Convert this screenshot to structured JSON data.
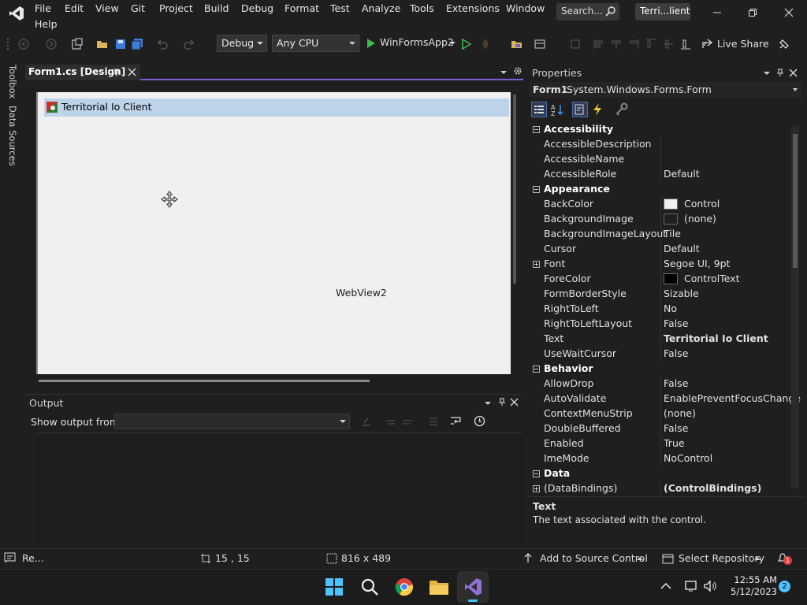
{
  "titlebar": {
    "menus": [
      "File",
      "Edit",
      "View",
      "Git",
      "Project",
      "Build",
      "Debug",
      "Format",
      "Test",
      "Analyze",
      "Tools",
      "Extensions",
      "Window",
      "Help"
    ],
    "search_label": "Search...",
    "solution_name": "Terri...lient"
  },
  "toolbar": {
    "config": "Debug",
    "platform": "Any CPU",
    "run_target": "WinFormsApp2",
    "live_share": "Live Share"
  },
  "leftstrip": {
    "toolbox": "Toolbox",
    "data_sources": "Data Sources"
  },
  "document": {
    "tab_title": "Form1.cs [Design]",
    "form_title": "Territorial Io Client",
    "control_label": "WebView2"
  },
  "output": {
    "title": "Output",
    "show_from_label": "Show output from:",
    "show_from_value": ""
  },
  "properties": {
    "title": "Properties",
    "object_name": "Form1",
    "object_type": "System.Windows.Forms.Form",
    "rows": [
      {
        "kind": "cat",
        "name": "Accessibility",
        "value": ""
      },
      {
        "kind": "prop",
        "name": "AccessibleDescription",
        "value": ""
      },
      {
        "kind": "prop",
        "name": "AccessibleName",
        "value": ""
      },
      {
        "kind": "prop",
        "name": "AccessibleRole",
        "value": "Default"
      },
      {
        "kind": "cat",
        "name": "Appearance",
        "value": ""
      },
      {
        "kind": "prop",
        "name": "BackColor",
        "value": "Control",
        "swatch": "#f0f0f0"
      },
      {
        "kind": "prop",
        "name": "BackgroundImage",
        "value": "(none)",
        "swatch": "#1f1f1f"
      },
      {
        "kind": "prop",
        "name": "BackgroundImageLayout",
        "value": "Tile"
      },
      {
        "kind": "prop",
        "name": "Cursor",
        "value": "Default"
      },
      {
        "kind": "expand",
        "name": "Font",
        "value": "Segoe UI, 9pt"
      },
      {
        "kind": "prop",
        "name": "ForeColor",
        "value": "ControlText",
        "swatch": "#000000"
      },
      {
        "kind": "prop",
        "name": "FormBorderStyle",
        "value": "Sizable"
      },
      {
        "kind": "prop",
        "name": "RightToLeft",
        "value": "No"
      },
      {
        "kind": "prop",
        "name": "RightToLeftLayout",
        "value": "False"
      },
      {
        "kind": "prop",
        "name": "Text",
        "value": "Territorial Io Client",
        "bold": true
      },
      {
        "kind": "prop",
        "name": "UseWaitCursor",
        "value": "False"
      },
      {
        "kind": "cat",
        "name": "Behavior",
        "value": ""
      },
      {
        "kind": "prop",
        "name": "AllowDrop",
        "value": "False"
      },
      {
        "kind": "prop",
        "name": "AutoValidate",
        "value": "EnablePreventFocusChange"
      },
      {
        "kind": "prop",
        "name": "ContextMenuStrip",
        "value": "(none)"
      },
      {
        "kind": "prop",
        "name": "DoubleBuffered",
        "value": "False"
      },
      {
        "kind": "prop",
        "name": "Enabled",
        "value": "True"
      },
      {
        "kind": "prop",
        "name": "ImeMode",
        "value": "NoControl"
      },
      {
        "kind": "cat",
        "name": "Data",
        "value": ""
      },
      {
        "kind": "expand",
        "name": "(DataBindings)",
        "value": "(ControlBindings)",
        "bold": true
      }
    ],
    "desc_title": "Text",
    "desc_text": "The text associated with the control."
  },
  "statusbar": {
    "ready": "Re...",
    "position": "15 , 15",
    "size": "816 x 489",
    "add_source": "Add to Source Control",
    "select_repo": "Select Repository",
    "notif_count": "1"
  },
  "taskbar": {
    "time": "12:55 AM",
    "date": "5/12/2023",
    "badge": "2"
  },
  "colors": {
    "accent": "#7a5ed8",
    "vs_purple": "#8f70d6",
    "form_title_bg": "#bcd3ea"
  }
}
